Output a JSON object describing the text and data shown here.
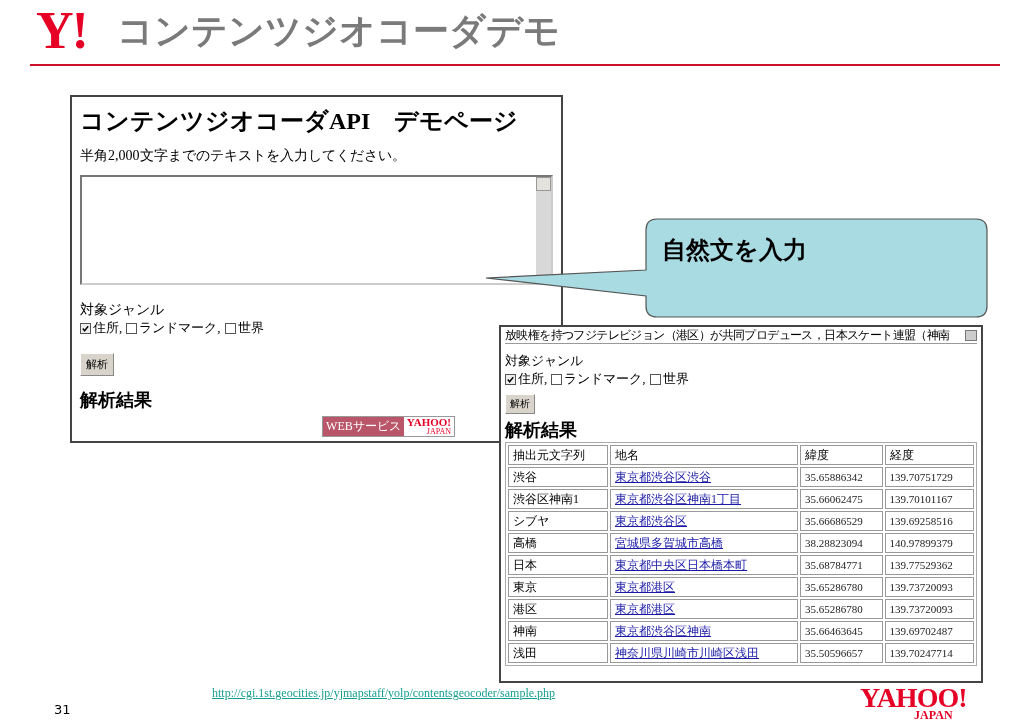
{
  "slide": {
    "logo": "Y!",
    "title": "コンテンツジオコーダデモ",
    "url": "http://cgi.1st.geocities.jp/yjmapstaff/yolp/contentsgeocoder/sample.php",
    "page_number": "31",
    "footer_logo": {
      "name": "YAHOO!",
      "region": "JAPAN"
    }
  },
  "demo_page": {
    "title": "コンテンツジオコーダAPI　デモページ",
    "instruction": "半角2,000文字までのテキストを入力してください。",
    "genre_label": "対象ジャンル",
    "genres": [
      {
        "label": "住所,",
        "checked": true
      },
      {
        "label": "ランドマーク,",
        "checked": false
      },
      {
        "label": "世界",
        "checked": false
      }
    ],
    "button": "解析",
    "results_heading": "解析結果",
    "badge": {
      "service": "WEBサービス",
      "brand": "YAHOO!",
      "region": "JAPAN"
    }
  },
  "callout": {
    "text": "自然文を入力"
  },
  "result_page": {
    "input_value": "放映権を持つフジテレビジョン（港区）が共同プロデュース，日本スケート連盟（神南",
    "genre_label": "対象ジャンル",
    "genres": [
      {
        "label": "住所,",
        "checked": true
      },
      {
        "label": "ランドマーク,",
        "checked": false
      },
      {
        "label": "世界",
        "checked": false
      }
    ],
    "button": "解析",
    "results_heading": "解析結果",
    "table": {
      "columns": [
        "抽出元文字列",
        "地名",
        "緯度",
        "経度"
      ],
      "rows": [
        {
          "source": "渋谷",
          "place": "東京都渋谷区渋谷",
          "latitude": "35.65886342",
          "longitude": "139.70751729"
        },
        {
          "source": "渋谷区神南1",
          "place": "東京都渋谷区神南1丁目",
          "latitude": "35.66062475",
          "longitude": "139.70101167"
        },
        {
          "source": "シブヤ",
          "place": "東京都渋谷区",
          "latitude": "35.66686529",
          "longitude": "139.69258516"
        },
        {
          "source": "高橋",
          "place": "宮城県多賀城市高橋",
          "latitude": "38.28823094",
          "longitude": "140.97899379"
        },
        {
          "source": "日本",
          "place": "東京都中央区日本橋本町",
          "latitude": "35.68784771",
          "longitude": "139.77529362"
        },
        {
          "source": "東京",
          "place": "東京都港区",
          "latitude": "35.65286780",
          "longitude": "139.73720093"
        },
        {
          "source": "港区",
          "place": "東京都港区",
          "latitude": "35.65286780",
          "longitude": "139.73720093"
        },
        {
          "source": "神南",
          "place": "東京都渋谷区神南",
          "latitude": "35.66463645",
          "longitude": "139.69702487"
        },
        {
          "source": "浅田",
          "place": "神奈川県川崎市川崎区浅田",
          "latitude": "35.50596657",
          "longitude": "139.70247714"
        }
      ]
    }
  }
}
